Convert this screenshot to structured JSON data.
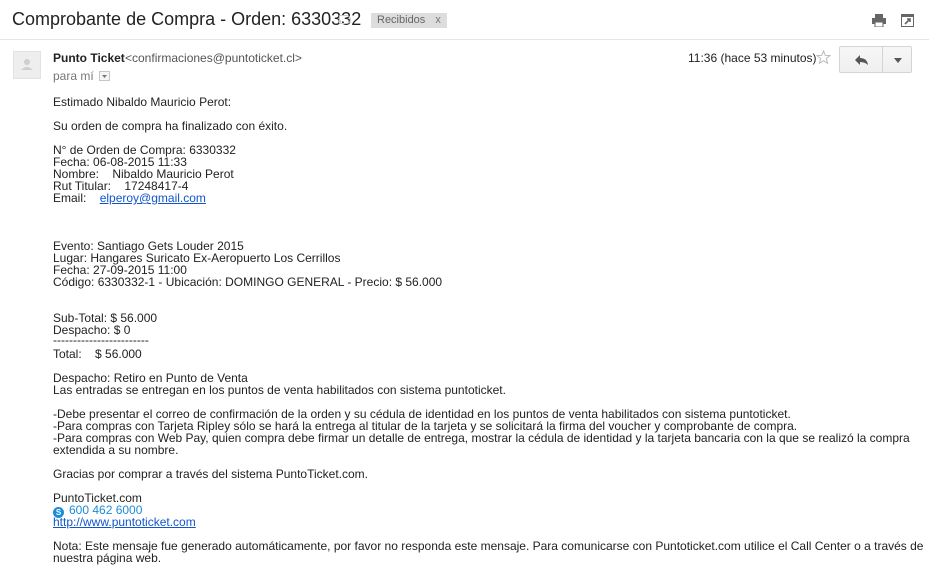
{
  "subject": "Comprobante de Compra - Orden: 6330332",
  "label": {
    "text": "Recibidos",
    "close": "x"
  },
  "sender": {
    "name": "Punto Ticket",
    "email": "<confirmaciones@puntoticket.cl>"
  },
  "to_line": "para mí",
  "timestamp": "11:36 (hace 53 minutos)",
  "body": {
    "greeting": "Estimado Nibaldo Mauricio Perot:",
    "success": "Su orden de compra ha finalizado con éxito.",
    "order_number": "N° de Orden de Compra: 6330332",
    "date": "Fecha: 06-08-2015 11:33",
    "name": "Nombre:    Nibaldo Mauricio Perot",
    "rut": "Rut Titular:    17248417-4",
    "email_label": "Email:    ",
    "email_value": "elperoy@gmail.com",
    "event": "Evento: Santiago Gets Louder 2015",
    "venue": "Lugar: Hangares Suricato Ex-Aeropuerto Los Cerrillos",
    "event_date": "Fecha: 27-09-2015 11:00",
    "code": "Código: 6330332-1 - Ubicación: DOMINGO GENERAL - Precio: $ 56.000",
    "subtotal": "Sub-Total: $ 56.000",
    "shipping": "Despacho: $ 0",
    "separator": "------------------------",
    "total": "Total:    $ 56.000",
    "delivery": "Despacho: Retiro en Punto de Venta",
    "delivery_info": "Las entradas se entregan en los puntos de venta habilitados con sistema puntoticket.",
    "note1": "-Debe presentar el correo de confirmación de la orden y su cédula de identidad en los puntos de venta habilitados con sistema puntoticket.",
    "note2": "-Para compras con Tarjeta Ripley sólo se hará la entrega al titular de la tarjeta y se solicitará la firma del voucher y comprobante de compra.",
    "note3a": "-Para compras con Web Pay, quien compra debe firmar un detalle de entrega, mostrar la cédula de identidad y la tarjeta bancaria con la que se realizó la compra",
    "note3b": "extendida a su nombre.",
    "thanks": "Gracias por comprar a través del sistema PuntoTicket.com.",
    "signature": "PuntoTicket.com",
    "phone": "600 462 6000",
    "website": "http://www.puntoticket.com",
    "footer_a": "Nota: Este mensaje fue generado automáticamente, por favor no responda este mensaje. Para comunicarse con Puntoticket.com utilice el Call Center o a través de",
    "footer_b": "nuestra página web."
  }
}
